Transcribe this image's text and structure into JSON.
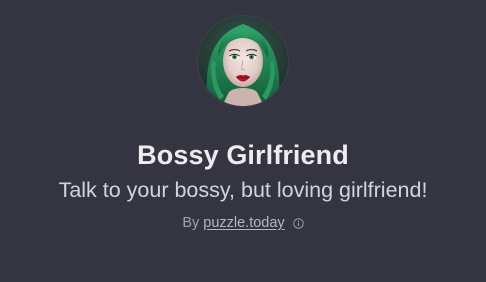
{
  "gpt": {
    "title": "Bossy Girlfriend",
    "description": "Talk to your bossy, but loving girlfriend!",
    "author_prefix": "By",
    "author_name": "puzzle.today",
    "avatar_icon": "avatar-portrait",
    "info_icon": "info-icon"
  },
  "colors": {
    "background": "#343541",
    "title": "#ececf1",
    "description": "#d1d5db",
    "muted": "#9ca3af"
  }
}
